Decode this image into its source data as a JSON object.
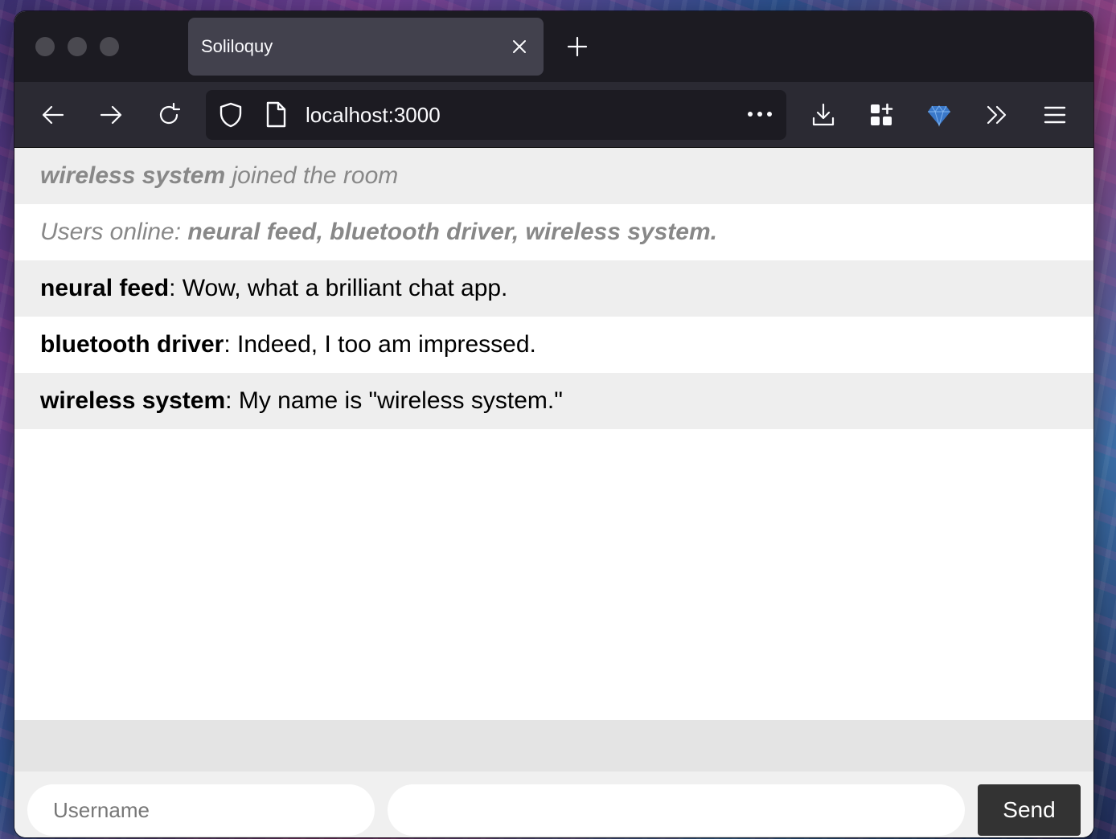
{
  "browser": {
    "tab_title": "Soliloquy",
    "url": "localhost:3000"
  },
  "icons": {
    "tab_close": "close-icon",
    "new_tab": "plus-icon",
    "back": "arrow-left-icon",
    "forward": "arrow-right-icon",
    "reload": "reload-icon",
    "shield": "shield-icon",
    "page": "page-icon",
    "more": "ellipsis-icon",
    "downloads": "download-icon",
    "extensions": "extensions-icon",
    "gem": "gem-icon",
    "overflow": "chevron-double-right-icon",
    "menu": "hamburger-menu-icon"
  },
  "messages": [
    {
      "type": "system",
      "user": "wireless system",
      "text": " joined the room"
    },
    {
      "type": "system-online",
      "prefix": "Users online: ",
      "users": "neural feed, bluetooth driver, wireless system."
    },
    {
      "type": "chat",
      "user": "neural feed",
      "text": ": Wow, what a brilliant chat app."
    },
    {
      "type": "chat",
      "user": "bluetooth driver",
      "text": ": Indeed, I too am impressed."
    },
    {
      "type": "chat",
      "user": "wireless system",
      "text": ": My name is \"wireless system.\""
    }
  ],
  "form": {
    "username_placeholder": "Username",
    "message_value": "",
    "send_label": "Send"
  },
  "colors": {
    "tabbar_bg": "#1c1b22",
    "navbar_bg": "#2b2a33",
    "active_tab_bg": "#42414d",
    "alt_row_bg": "#eeeeee",
    "system_text": "#888888",
    "send_button_bg": "#333333"
  }
}
